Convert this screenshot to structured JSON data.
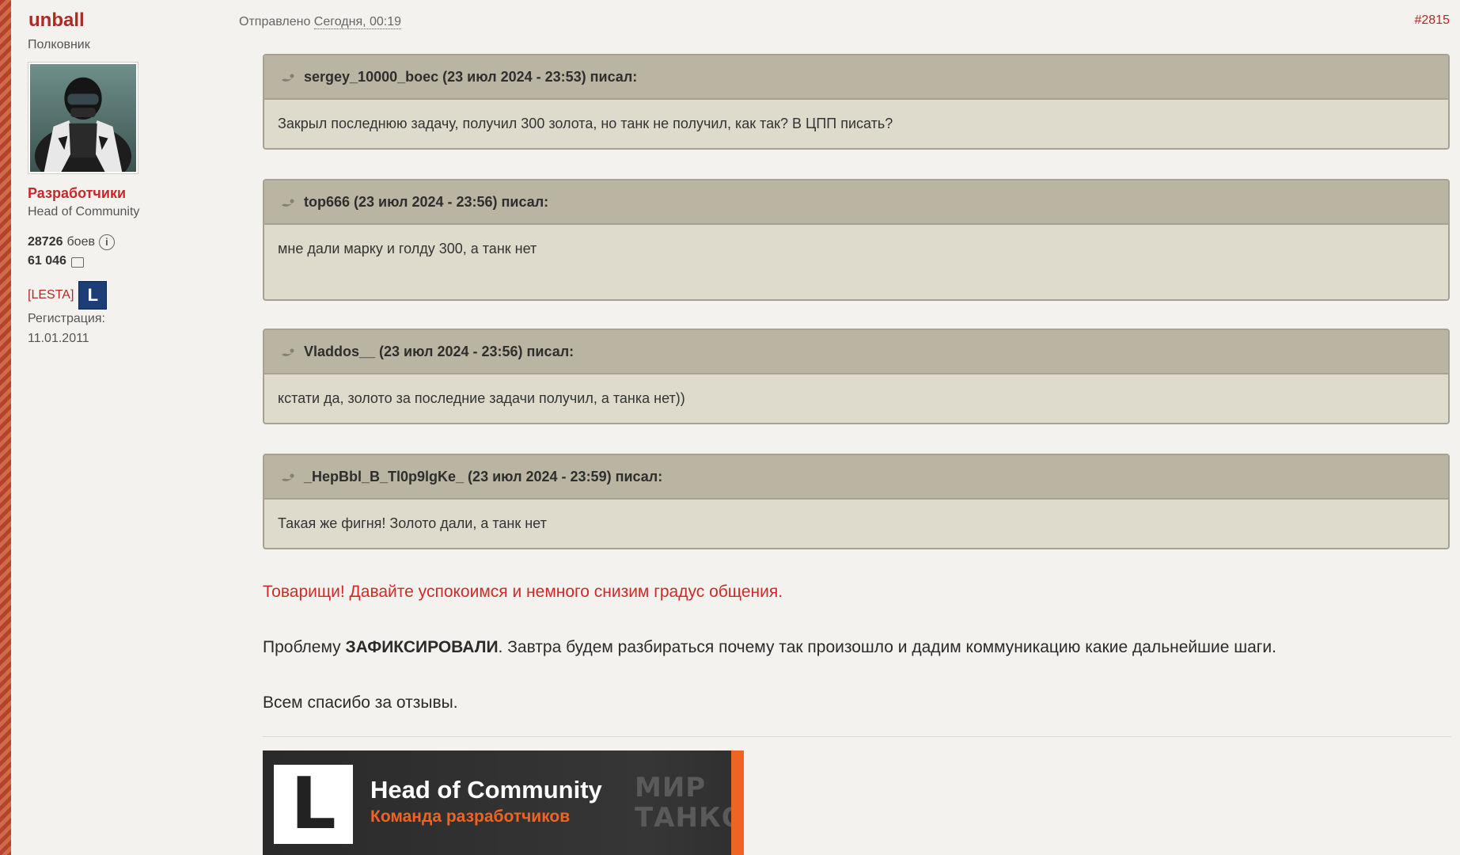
{
  "author": {
    "name": "unball",
    "rank": "Полковник",
    "group": "Разработчики",
    "title": "Head of Community",
    "battles_count": "28726",
    "battles_label": "боев",
    "posts_count": "61 046",
    "clan_tag": "[LESTA]",
    "clan_badge": "L",
    "registration_label": "Регистрация:",
    "registration_date": "11.01.2011"
  },
  "post": {
    "sent_label": "Отправлено",
    "sent_date": "Сегодня, 00:19",
    "number": "#2815"
  },
  "quotes": [
    {
      "header": "sergey_10000_boec (23 июл 2024 - 23:53) писал:",
      "text": "Закрыл последнюю задачу, получил 300 золота, но танк не получил, как так? В ЦПП писать?"
    },
    {
      "header": "top666 (23 июл 2024 - 23:56) писал:",
      "text": "мне дали марку и голду 300, а танк нет"
    },
    {
      "header": "Vladdos__ (23 июл 2024 - 23:56) писал:",
      "text": "кстати да, золото за последние задачи получил, а танка нет))"
    },
    {
      "header": "_HepBbl_B_Tl0p9lgKe_ (23 июл 2024 - 23:59) писал:",
      "text": "Такая же фигня! Золото дали, а танк нет"
    }
  ],
  "body": {
    "warning": "Товарищи! Давайте успокоимся и немного снизим градус общения.",
    "main_prefix": "Проблему ",
    "main_bold": "ЗАФИКСИРОВАЛИ",
    "main_suffix": ". Завтра будем разбираться почему так произошло и дадим коммуникацию какие дальнейшие шаги.",
    "thanks": "Всем спасибо за отзывы."
  },
  "signature": {
    "logo_letter": "L",
    "title": "Head of Community",
    "subtitle": "Команда разработчиков",
    "brand_line1": "МИР",
    "brand_line2": "ТАНКОВ"
  },
  "colors": {
    "accent_red": "#b02a24",
    "warning_red": "#cf2a27",
    "quote_header": "#b9b5a2",
    "quote_body": "#dedbcc",
    "signature_orange": "#f06423"
  },
  "icons": {
    "info": "info-circle-icon",
    "posts": "speech-bubble-icon",
    "quote": "quote-icon"
  }
}
